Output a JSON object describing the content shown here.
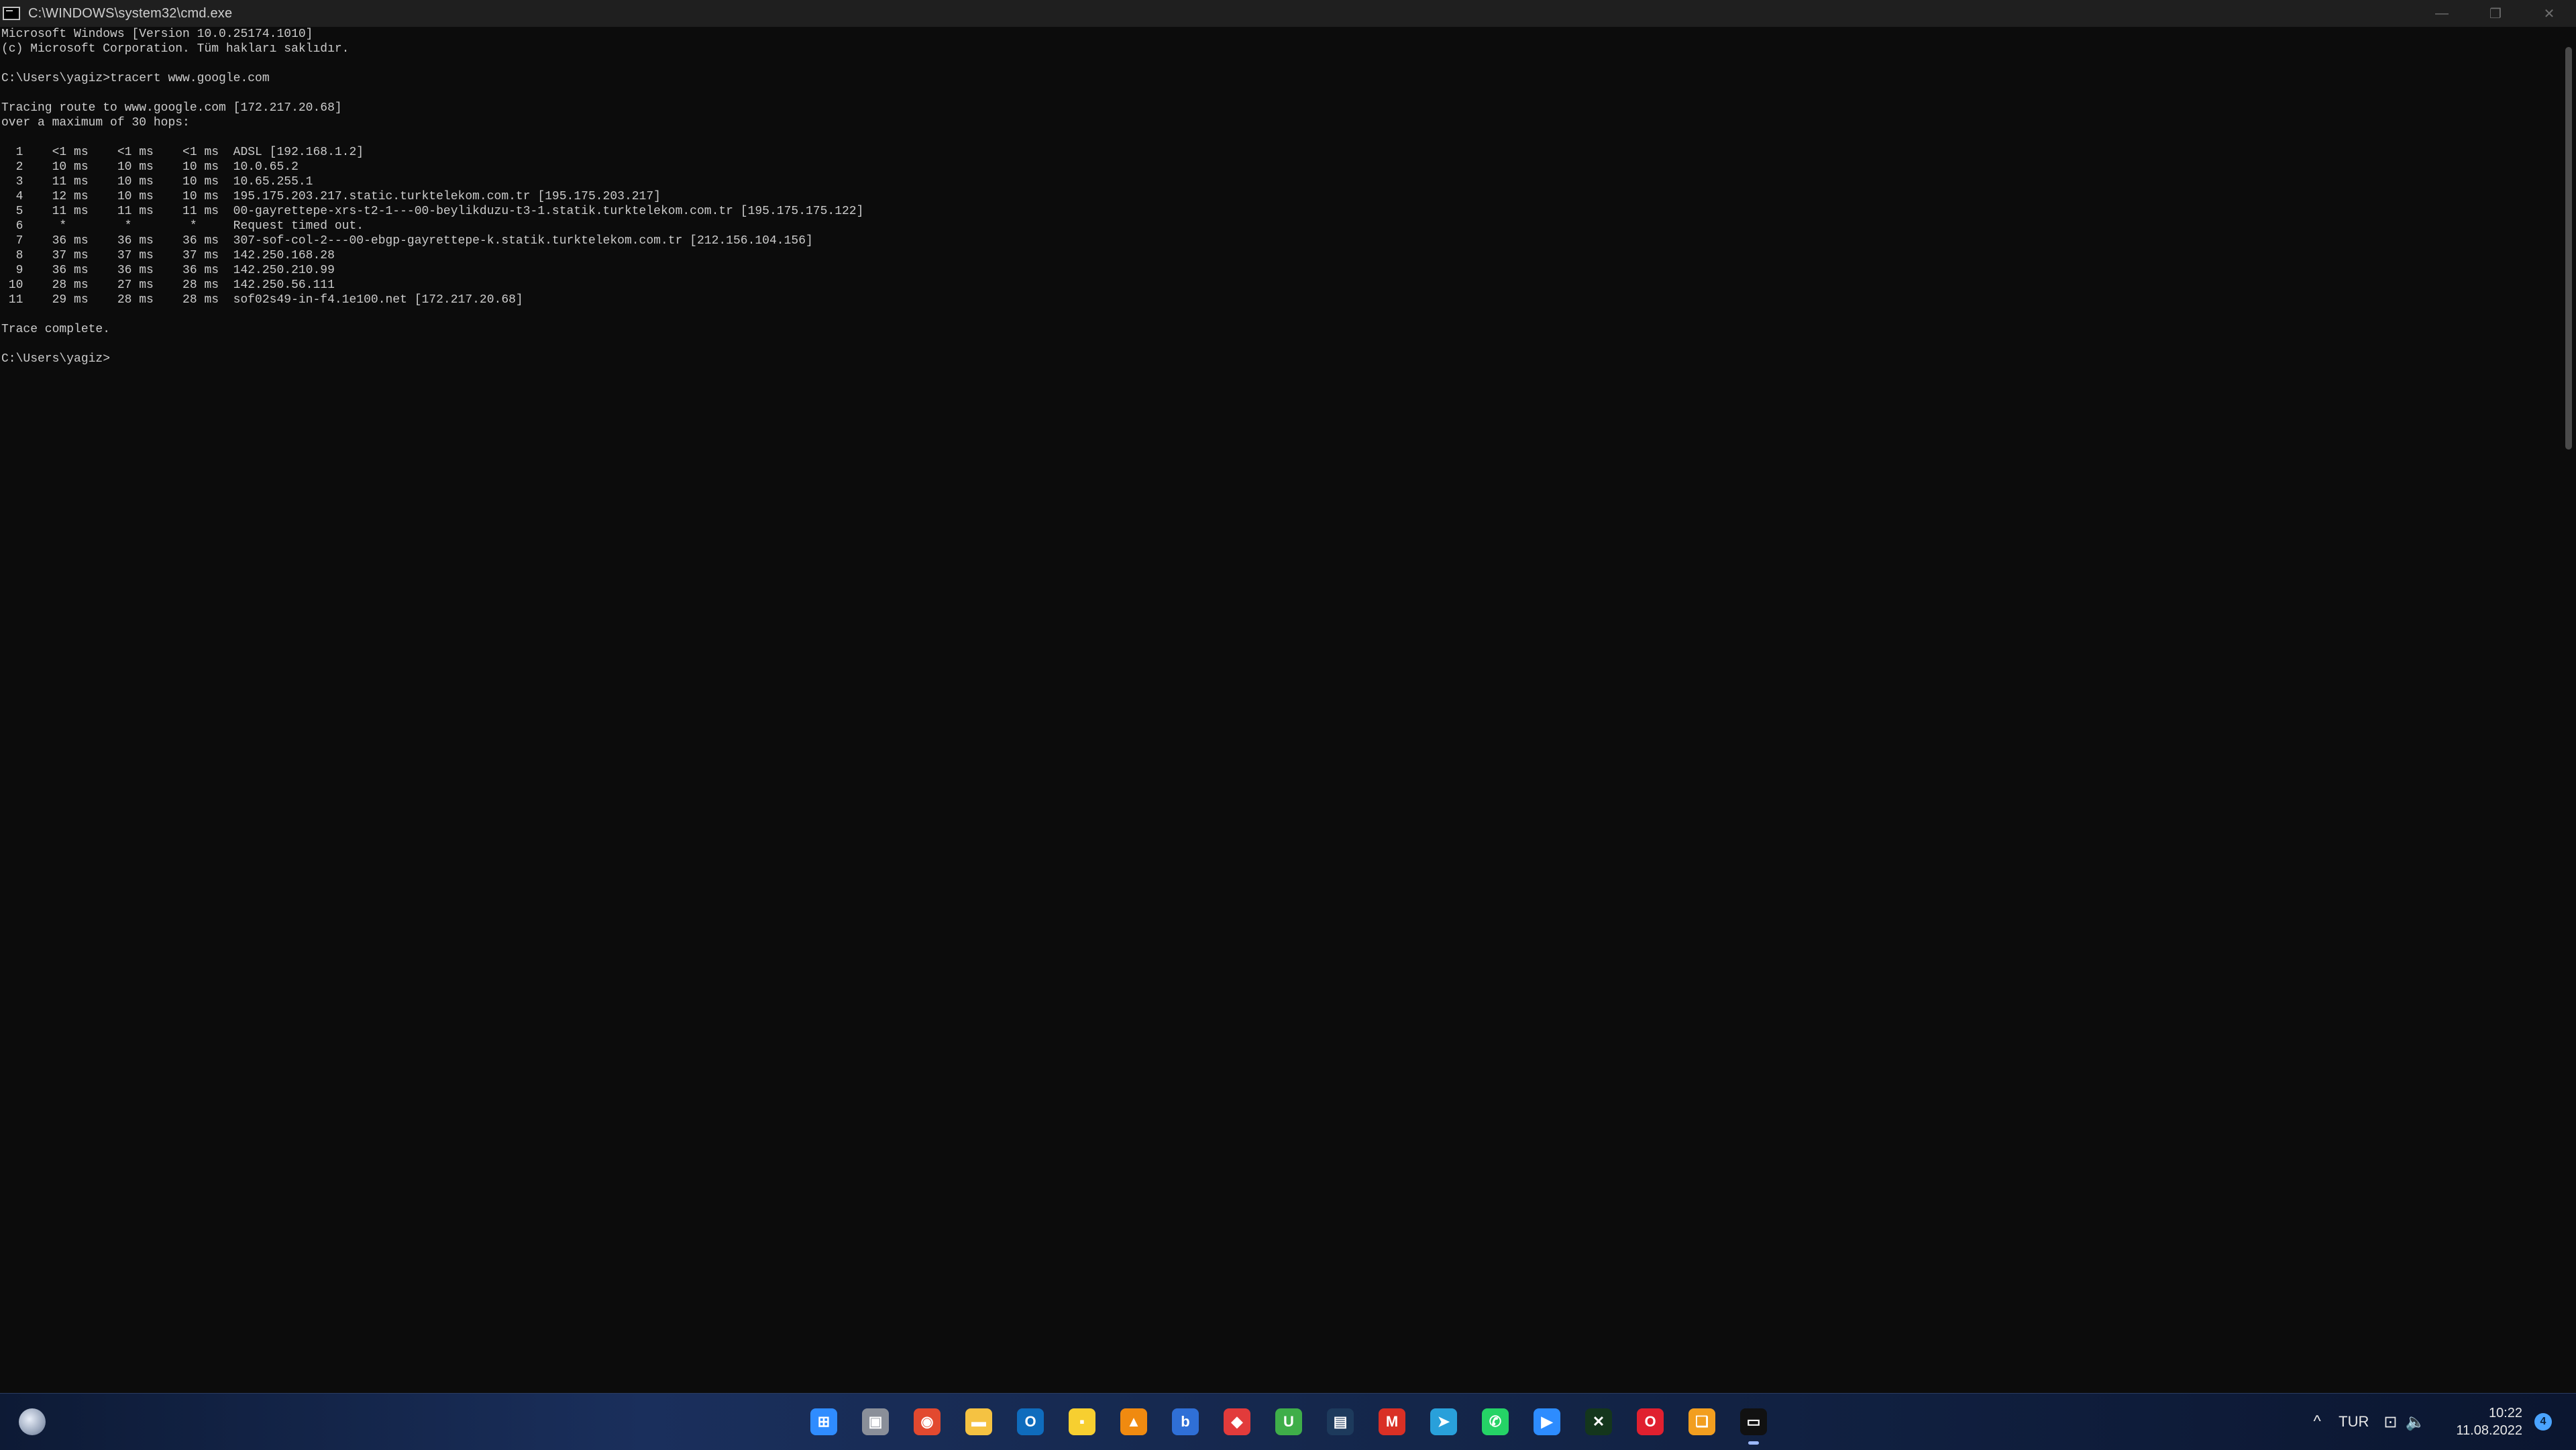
{
  "window": {
    "title": "C:\\WINDOWS\\system32\\cmd.exe",
    "minimize_label": "—",
    "restore_label": "❐",
    "close_label": "✕"
  },
  "console": {
    "lines": [
      "Microsoft Windows [Version 10.0.25174.1010]",
      "(c) Microsoft Corporation. Tüm hakları saklıdır.",
      "",
      "C:\\Users\\yagiz>tracert www.google.com",
      "",
      "Tracing route to www.google.com [172.217.20.68]",
      "over a maximum of 30 hops:",
      "",
      "  1    <1 ms    <1 ms    <1 ms  ADSL [192.168.1.2]",
      "  2    10 ms    10 ms    10 ms  10.0.65.2",
      "  3    11 ms    10 ms    10 ms  10.65.255.1",
      "  4    12 ms    10 ms    10 ms  195.175.203.217.static.turktelekom.com.tr [195.175.203.217]",
      "  5    11 ms    11 ms    11 ms  00-gayrettepe-xrs-t2-1---00-beylikduzu-t3-1.statik.turktelekom.com.tr [195.175.175.122]",
      "  6     *        *        *     Request timed out.",
      "  7    36 ms    36 ms    36 ms  307-sof-col-2---00-ebgp-gayrettepe-k.statik.turktelekom.com.tr [212.156.104.156]",
      "  8    37 ms    37 ms    37 ms  142.250.168.28",
      "  9    36 ms    36 ms    36 ms  142.250.210.99",
      " 10    28 ms    27 ms    28 ms  142.250.56.111",
      " 11    29 ms    28 ms    28 ms  sof02s49-in-f4.1e100.net [172.217.20.68]",
      "",
      "Trace complete.",
      "",
      "C:\\Users\\yagiz>"
    ]
  },
  "taskbar": {
    "apps": [
      {
        "name": "start-button-icon",
        "glyph": "⊞",
        "color": "#2f8cff"
      },
      {
        "name": "task-view-icon",
        "glyph": "▣",
        "color": "#8a8f99"
      },
      {
        "name": "chrome-icon",
        "glyph": "◉",
        "color": "#e2492f"
      },
      {
        "name": "file-explorer-icon",
        "glyph": "▬",
        "color": "#f5c242"
      },
      {
        "name": "outlook-icon",
        "glyph": "O",
        "color": "#0f6cbd"
      },
      {
        "name": "sticky-notes-icon",
        "glyph": "▪",
        "color": "#f7cf30"
      },
      {
        "name": "vlc-icon",
        "glyph": "▲",
        "color": "#f08a10"
      },
      {
        "name": "bitwarden-icon",
        "glyph": "b",
        "color": "#2f6fd6"
      },
      {
        "name": "anydesk-icon",
        "glyph": "◆",
        "color": "#e23b3b"
      },
      {
        "name": "utorrent-icon",
        "glyph": "U",
        "color": "#3fae49"
      },
      {
        "name": "stats-app-icon",
        "glyph": "▤",
        "color": "#1d3a5c"
      },
      {
        "name": "gmail-icon",
        "glyph": "M",
        "color": "#d93025"
      },
      {
        "name": "telegram-icon",
        "glyph": "➤",
        "color": "#29a0da"
      },
      {
        "name": "whatsapp-icon",
        "glyph": "✆",
        "color": "#25d366"
      },
      {
        "name": "zoom-icon",
        "glyph": "▶",
        "color": "#2d8cff"
      },
      {
        "name": "xbox-app-icon",
        "glyph": "✕",
        "color": "#14361c"
      },
      {
        "name": "opera-icon",
        "glyph": "O",
        "color": "#e0202f"
      },
      {
        "name": "gallery-icon",
        "glyph": "❏",
        "color": "#f29e1f"
      },
      {
        "name": "terminal-icon",
        "glyph": "▭",
        "color": "#111111"
      }
    ],
    "tray": {
      "chevron": "^",
      "language": "TUR",
      "network_glyph": "⊡",
      "volume_glyph": "🔈",
      "time": "10:22",
      "date": "11.08.2022",
      "notifications_count": "4"
    }
  }
}
